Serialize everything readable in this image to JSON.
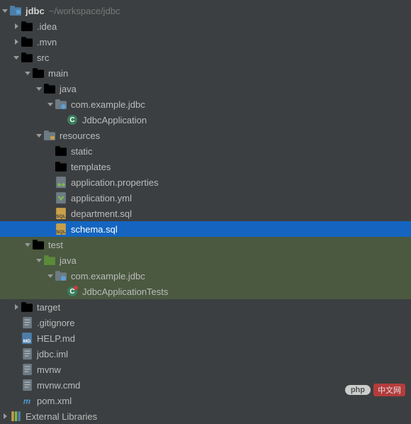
{
  "project": {
    "name": "jdbc",
    "path": "~/workspace/jdbc"
  },
  "nodes": {
    "idea": ".idea",
    "mvn": ".mvn",
    "src": "src",
    "main": "main",
    "java_main": "java",
    "pkg_main": "com.example.jdbc",
    "app_class": "JdbcApplication",
    "resources": "resources",
    "static": "static",
    "templates": "templates",
    "app_props": "application.properties",
    "app_yml": "application.yml",
    "dept_sql": "department.sql",
    "schema_sql": "schema.sql",
    "test": "test",
    "java_test": "java",
    "pkg_test": "com.example.jdbc",
    "test_class": "JdbcApplicationTests",
    "target": "target",
    "gitignore": ".gitignore",
    "help_md": "HELP.md",
    "jdbc_iml": "jdbc.iml",
    "mvnw": "mvnw",
    "mvnw_cmd": "mvnw.cmd",
    "pom_xml": "pom.xml",
    "ext_libs": "External Libraries"
  },
  "watermark": {
    "php": "php",
    "cn": "中文网"
  }
}
